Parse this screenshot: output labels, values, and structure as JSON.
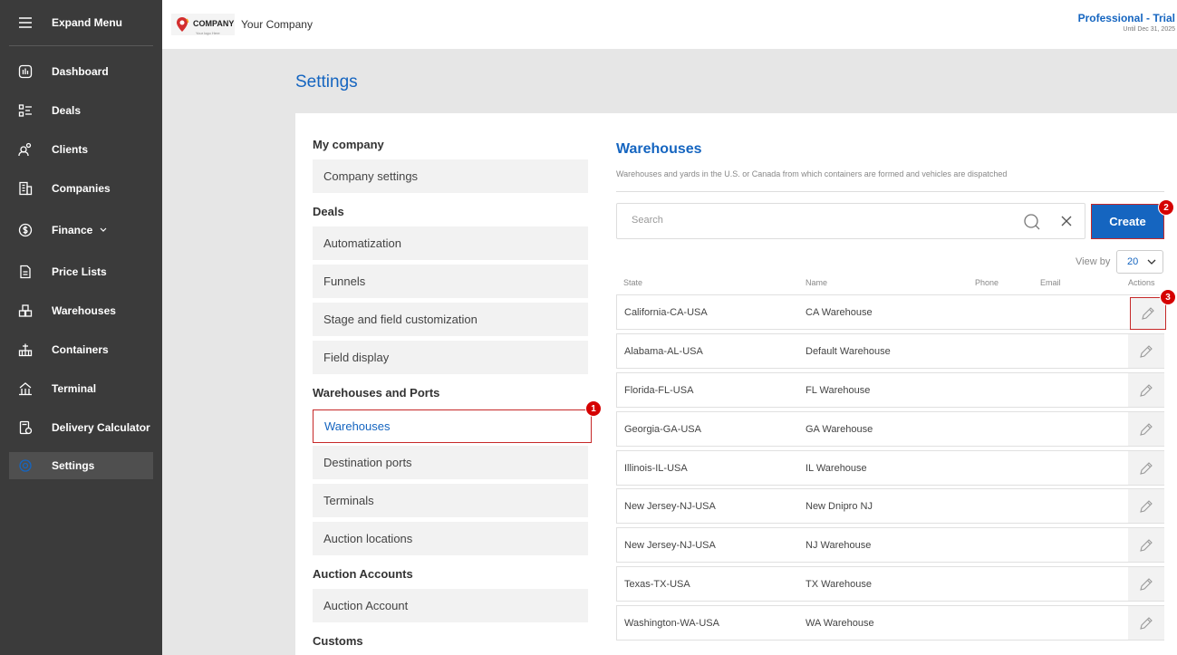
{
  "sidebar": {
    "expand_label": "Expand Menu",
    "items": [
      {
        "label": "Dashboard",
        "icon": "dashboard-icon"
      },
      {
        "label": "Deals",
        "icon": "deals-list-icon"
      },
      {
        "label": "Clients",
        "icon": "clients-icon"
      },
      {
        "label": "Companies",
        "icon": "companies-building-icon"
      },
      {
        "label": "Finance",
        "icon": "finance-icon"
      },
      {
        "label": "Price Lists",
        "icon": "price-list-icon"
      },
      {
        "label": "Warehouses",
        "icon": "warehouse-icon"
      },
      {
        "label": "Containers",
        "icon": "containers-icon"
      },
      {
        "label": "Terminal",
        "icon": "terminal-icon"
      },
      {
        "label": "Delivery Calculator",
        "icon": "calculator-icon"
      },
      {
        "label": "Settings",
        "icon": "settings-gear-icon"
      }
    ],
    "active": "Settings"
  },
  "header": {
    "logo_text": "COMPANY",
    "logo_sub": "Your logo Here",
    "company_name": "Your Company",
    "plan": "Professional - Trial",
    "plan_until": "Until Dec 31, 2025"
  },
  "page": {
    "title": "Settings"
  },
  "settings_nav": {
    "groups": [
      {
        "title": "My company",
        "items": [
          "Company settings"
        ]
      },
      {
        "title": "Deals",
        "items": [
          "Automatization",
          "Funnels",
          "Stage and field customization",
          "Field display"
        ]
      },
      {
        "title": "Warehouses and Ports",
        "items": [
          "Warehouses",
          "Destination ports",
          "Terminals",
          "Auction locations"
        ]
      },
      {
        "title": "Auction Accounts",
        "items": [
          "Auction Account"
        ]
      },
      {
        "title": "Customs",
        "items": []
      }
    ],
    "active_item": "Warehouses"
  },
  "warehouses": {
    "title": "Warehouses",
    "description": "Warehouses and yards in the U.S. or Canada from which containers are formed and vehicles are dispatched",
    "search_placeholder": "Search",
    "create_label": "Create",
    "view_by_label": "View by",
    "view_by_value": "20",
    "columns": {
      "state": "State",
      "name": "Name",
      "phone": "Phone",
      "email": "Email",
      "actions": "Actions"
    },
    "rows": [
      {
        "state": "California-CA-USA",
        "name": "CA Warehouse"
      },
      {
        "state": "Alabama-AL-USA",
        "name": "Default Warehouse"
      },
      {
        "state": "Florida-FL-USA",
        "name": "FL Warehouse"
      },
      {
        "state": "Georgia-GA-USA",
        "name": "GA Warehouse"
      },
      {
        "state": "Illinois-IL-USA",
        "name": "IL Warehouse"
      },
      {
        "state": "New Jersey-NJ-USA",
        "name": "New Dnipro NJ"
      },
      {
        "state": "New Jersey-NJ-USA",
        "name": "NJ Warehouse"
      },
      {
        "state": "Texas-TX-USA",
        "name": "TX Warehouse"
      },
      {
        "state": "Washington-WA-USA",
        "name": "WA Warehouse"
      }
    ]
  },
  "badges": [
    "1",
    "2",
    "3"
  ],
  "colors": {
    "accent": "#1565c0",
    "sidebar": "#3b3b3b",
    "highlight": "#c62828",
    "badge": "#d50000"
  }
}
